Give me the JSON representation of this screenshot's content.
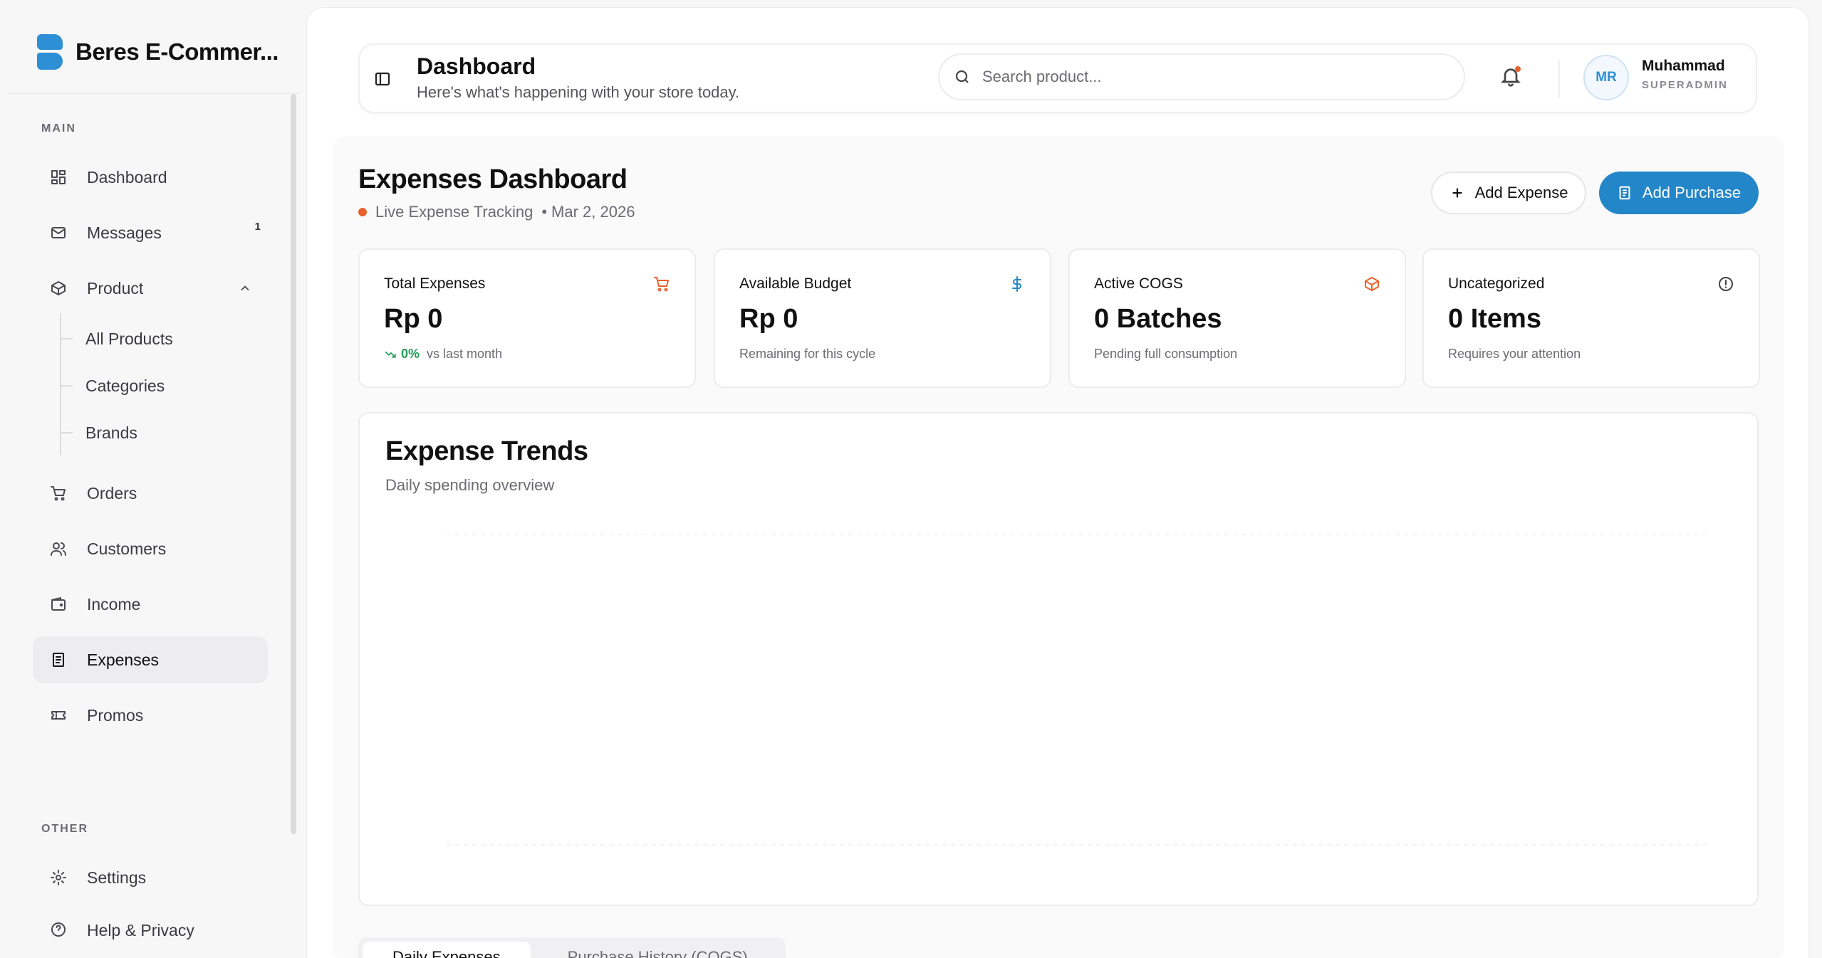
{
  "brand": {
    "name": "Beres E-Commer...",
    "color": "#2d8fd6"
  },
  "sidebar": {
    "main_label": "MAIN",
    "other_label": "OTHER",
    "items": [
      {
        "label": "Dashboard",
        "icon": "grid-icon"
      },
      {
        "label": "Messages",
        "icon": "mail-icon",
        "badge": "1"
      },
      {
        "label": "Product",
        "icon": "box-icon",
        "expanded": true
      },
      {
        "label": "Orders",
        "icon": "cart-icon"
      },
      {
        "label": "Customers",
        "icon": "users-icon"
      },
      {
        "label": "Income",
        "icon": "wallet-icon"
      },
      {
        "label": "Expenses",
        "icon": "receipt-icon",
        "active": true
      },
      {
        "label": "Promos",
        "icon": "ticket-icon"
      }
    ],
    "product_sub": [
      "All Products",
      "Categories",
      "Brands"
    ],
    "other_items": [
      {
        "label": "Settings",
        "icon": "gear-icon"
      },
      {
        "label": "Help & Privacy",
        "icon": "help-icon"
      }
    ]
  },
  "topbar": {
    "title": "Dashboard",
    "subtitle": "Here's what's happening with your store today.",
    "search_placeholder": "Search product...",
    "user": {
      "initials": "MR",
      "name": "Muhammad",
      "role": "SUPERADMIN"
    }
  },
  "page": {
    "title": "Expenses Dashboard",
    "live_text": "Live Expense Tracking",
    "date": "Mar 2, 2026",
    "add_expense_label": "Add Expense",
    "add_purchase_label": "Add Purchase"
  },
  "stats": [
    {
      "label": "Total Expenses",
      "value": "Rp 0",
      "trend": "0%",
      "foot": "vs last month",
      "icon": "cart-icon",
      "color": "#e8612c"
    },
    {
      "label": "Available Budget",
      "value": "Rp 0",
      "foot": "Remaining for this cycle",
      "icon": "dollar-icon",
      "color": "#2386c8"
    },
    {
      "label": "Active COGS",
      "value": "0 Batches",
      "foot": "Pending full consumption",
      "icon": "cube-icon",
      "color": "#e8612c"
    },
    {
      "label": "Uncategorized",
      "value": "0 Items",
      "foot": "Requires your attention",
      "icon": "info-icon",
      "color": "#444444"
    }
  ],
  "chart": {
    "title": "Expense Trends",
    "subtitle": "Daily spending overview"
  },
  "chart_data": {
    "type": "area",
    "series": []
  },
  "tabs": [
    {
      "label": "Daily Expenses",
      "active": true
    },
    {
      "label": "Purchase History (COGS)",
      "active": false
    }
  ],
  "colors": {
    "accent": "#2386c8",
    "warning": "#e8612c",
    "success": "#1f9d55"
  }
}
